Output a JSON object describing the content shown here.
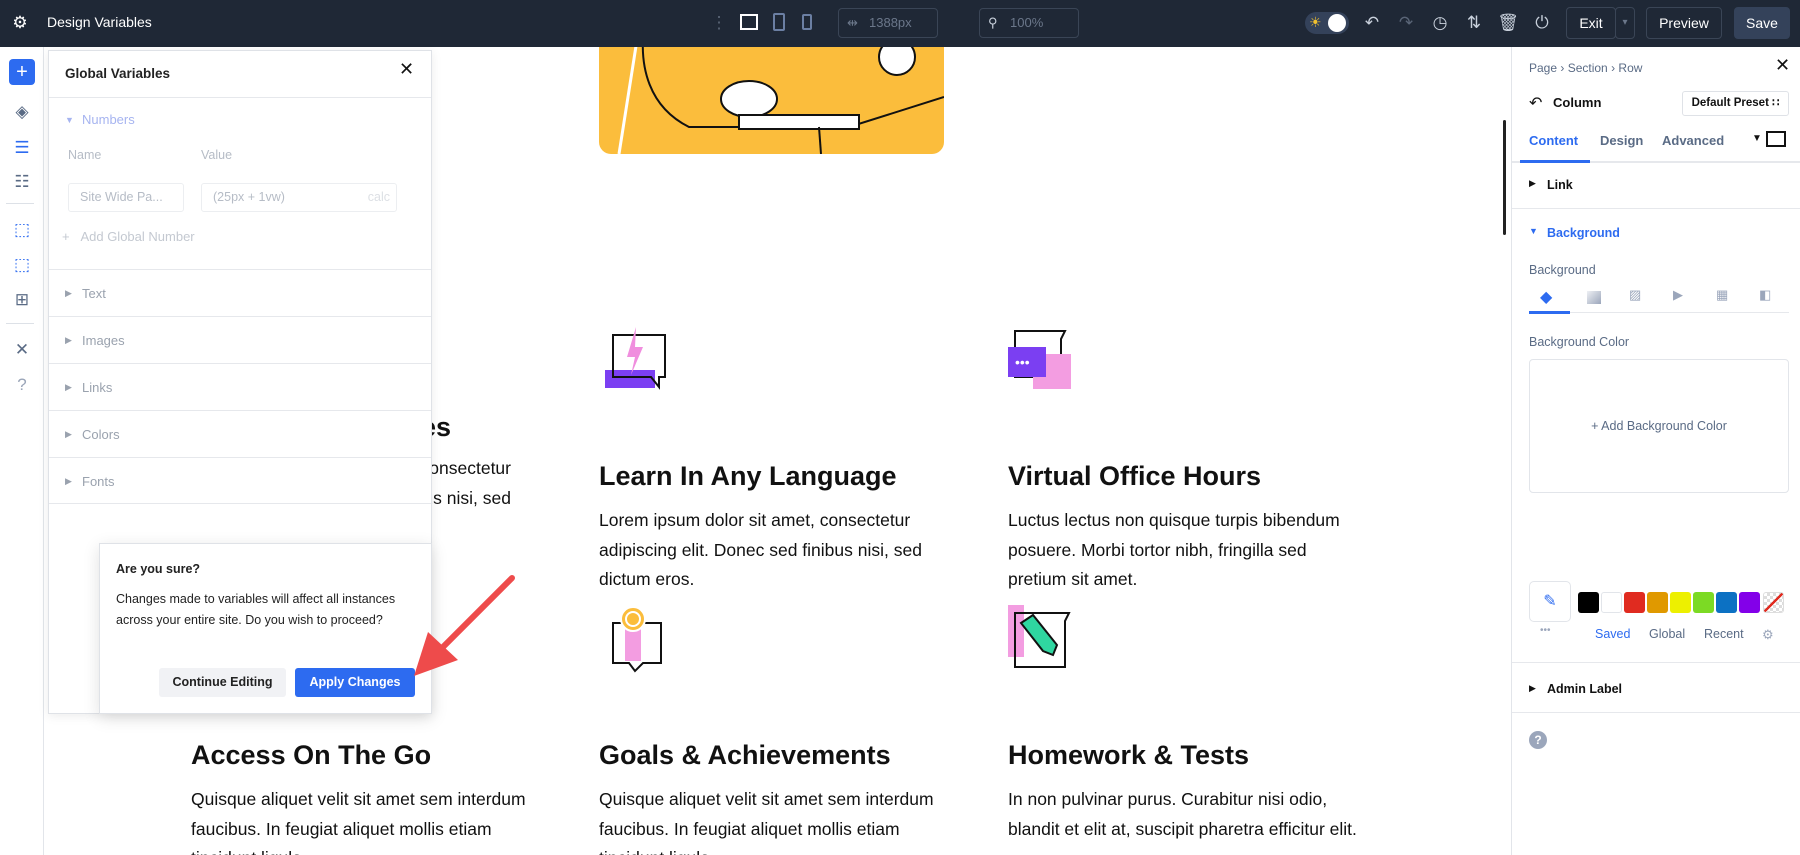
{
  "topbar": {
    "title": "Design Variables",
    "width_value": "1388px",
    "zoom_value": "100%",
    "exit_label": "Exit",
    "preview_label": "Preview",
    "save_label": "Save"
  },
  "global_variables": {
    "title": "Global Variables",
    "numbers_label": "Numbers",
    "name_header": "Name",
    "value_header": "Value",
    "name_input": "Site Wide Pa...",
    "value_input": "(25px + 1vw)",
    "value_suffix": "calc",
    "add_label": "Add Global Number",
    "sections": [
      "Text",
      "Images",
      "Links",
      "Colors",
      "Fonts"
    ]
  },
  "dialog": {
    "title": "Are you sure?",
    "message": "Changes made to variables will affect all instances across your entire site. Do you wish to proceed?",
    "continue_label": "Continue Editing",
    "apply_label": "Apply Changes"
  },
  "canvas": {
    "partial": {
      "heading_tail": "es",
      "line1_tail": "onsectetur",
      "line2_tail": "bus nisi, sed"
    },
    "features": [
      {
        "title": "Learn In Any Language",
        "body": "Lorem ipsum dolor sit amet, consectetur adipiscing elit. Donec sed finibus nisi, sed dictum eros."
      },
      {
        "title": "Virtual Office Hours",
        "body": "Luctus lectus non quisque turpis bibendum posuere. Morbi tortor nibh, fringilla sed pretium sit amet."
      },
      {
        "title": "Access On The Go",
        "body": "Quisque aliquet velit sit amet sem interdum faucibus. In feugiat aliquet mollis etiam tincidunt ligula."
      },
      {
        "title": "Goals & Achievements",
        "body": "Quisque aliquet velit sit amet sem interdum faucibus. In feugiat aliquet mollis etiam tincidunt ligula."
      },
      {
        "title": "Homework & Tests",
        "body": "In non pulvinar purus. Curabitur nisi odio, blandit et elit at, suscipit pharetra efficitur elit."
      }
    ]
  },
  "right_panel": {
    "breadcrumb": [
      "Page",
      "Section",
      "Row"
    ],
    "element": "Column",
    "preset": "Default Preset",
    "tabs": [
      "Content",
      "Design",
      "Advanced"
    ],
    "link_label": "Link",
    "background_section": "Background",
    "background_label": "Background",
    "bg_color_label": "Background Color",
    "add_bg_color": "Add Background Color",
    "palette_tabs": [
      "Saved",
      "Global",
      "Recent"
    ],
    "admin_label": "Admin Label",
    "swatches": [
      "#000000",
      "#ffffff",
      "#e02b20",
      "#e09900",
      "#edf000",
      "#7cda24",
      "#0c71c3",
      "#8300e9"
    ]
  },
  "colors": {
    "accent": "#2d6bf0",
    "topbar": "#1f2836",
    "arrow": "#ee4b4b"
  }
}
